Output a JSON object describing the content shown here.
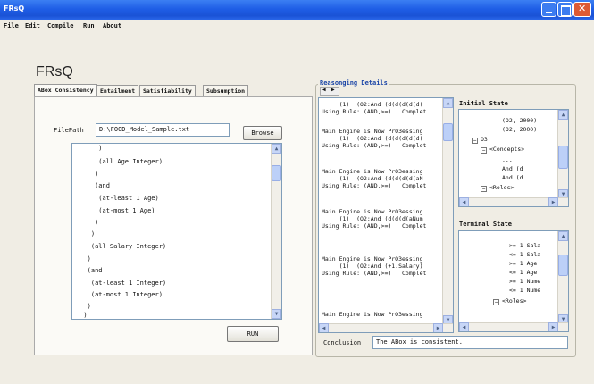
{
  "window": {
    "title": "FRsQ"
  },
  "menu": [
    "File",
    "Edit",
    "Compile",
    "Run",
    "About"
  ],
  "app_title": "FRsQ",
  "tabs": [
    "ABox Consistency",
    "Entailment",
    "Satisfiability",
    "Subsumption"
  ],
  "tab_scroll": {
    "left": "◀",
    "right": "▶"
  },
  "abox": {
    "filepath_label": "FilePath",
    "filepath_value": "D:\\FOOD_Model_Sample.txt",
    "browse_label": "Browse",
    "code_lines": [
      "      )",
      "      (all Age Integer)",
      "     )",
      "     (and",
      "      (at-least 1 Age)",
      "      (at-most 1 Age)",
      "     )",
      "    )",
      "    (all Salary Integer)",
      "   )",
      "   (and",
      "    (at-least 1 Integer)",
      "    (at-most 1 Integer)",
      "   )",
      "  )"
    ],
    "run_label": "RUN"
  },
  "reasoning": {
    "title": "Reasonging Details",
    "log_lines": [
      "     (1)  (O2:And (d(d(d(d(d(",
      "Using Rule: (AND,>=)   Complet",
      "",
      "",
      "Main Engine is Now PrO3essing",
      "     (1)  (O2:And (d(d(d(d(d(",
      "Using Rule: (AND,>=)   Complet",
      "",
      "Main Engine is Now PrO3essing",
      "     (1)  (O2:And (d(d(d(d(aN",
      "Using Rule: (AND,>=)   Complet",
      "",
      "Main Engine is Now PrO3essing",
      "     (1)  (O2:And (d(d(d(aNum",
      "Using Rule: (AND,>=)   Complet",
      "",
      "Main Engine is Now PrO3essing",
      "     (1)  (O2:And (+1.Salary)",
      "Using Rule: (AND,>=)   Complet",
      "",
      "",
      "Main Engine is Now PrO3essing"
    ],
    "initial_state_label": "Initial State",
    "initial_tree": [
      "(O2, 2000)",
      "(O2, 2000)",
      "O3",
      "<Concepts>",
      "...",
      "And (d",
      "And (d",
      "<Roles>"
    ],
    "terminal_state_label": "Terminal State",
    "terminal_tree": [
      ">= 1 Sala",
      "<= 1 Sala",
      ">= 1 Age",
      "<= 1 Age",
      ">= 1 Nume",
      "<= 1 Nume",
      "<Roles>"
    ],
    "conclusion_label": "Conclusion",
    "conclusion_value": "The ABox is consistent."
  },
  "colors": {
    "titlebar": "#1f5ee6",
    "group_title": "#1d47a7",
    "scroll_thumb": "#bcd0f8"
  }
}
